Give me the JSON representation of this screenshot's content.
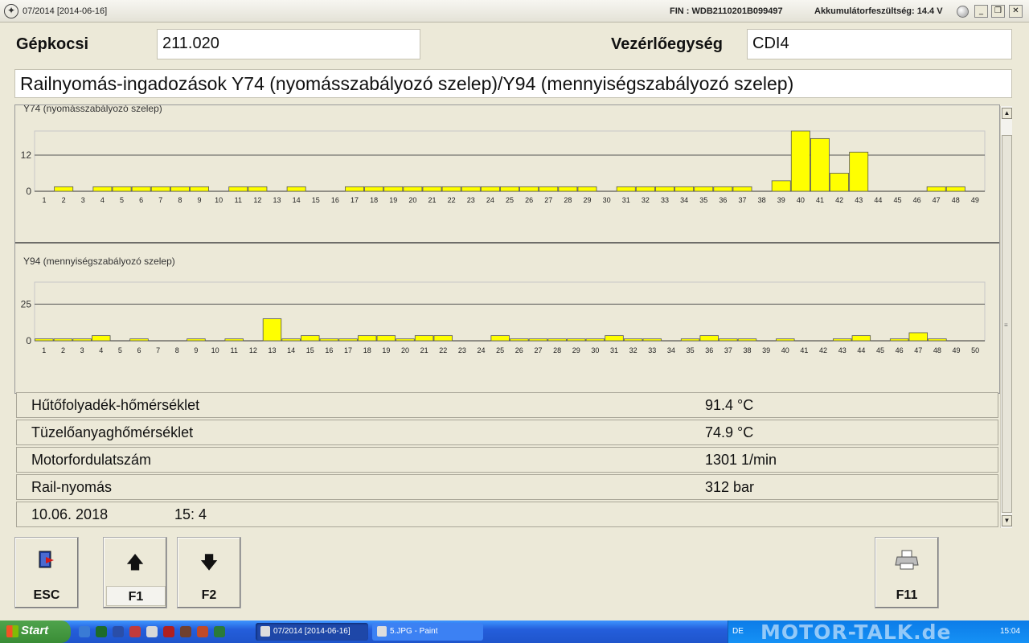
{
  "window": {
    "title": "07/2014 [2014-06-16]",
    "fin": "FIN : WDB2110201B099497",
    "battery": "Akkumulátorfeszültség: 14.4 V",
    "controls": {
      "minimize": "_",
      "restore": "❐",
      "close": "✕"
    }
  },
  "header": {
    "vehicle_label": "Gépkocsi",
    "vehicle_value": "211.020",
    "ecu_label": "Vezérlőegység",
    "ecu_value": "CDI4",
    "page_title": "Railnyomás-ingadozások Y74 (nyomásszabályozó szelep)/Y94 (mennyiségszabályozó szelep)"
  },
  "chart_data": [
    {
      "type": "bar",
      "title": "Y74 (nyomásszabályozó szelep)",
      "categories": [
        "1",
        "2",
        "3",
        "4",
        "5",
        "6",
        "7",
        "8",
        "9",
        "10",
        "11",
        "12",
        "13",
        "14",
        "15",
        "16",
        "17",
        "18",
        "19",
        "20",
        "21",
        "22",
        "23",
        "24",
        "25",
        "26",
        "27",
        "28",
        "29",
        "30",
        "31",
        "32",
        "33",
        "34",
        "35",
        "36",
        "37",
        "38",
        "39",
        "40",
        "41",
        "42",
        "43",
        "44",
        "45",
        "46",
        "47",
        "48",
        "49"
      ],
      "values": [
        0,
        1.5,
        0,
        1.5,
        1.5,
        1.5,
        1.5,
        1.5,
        1.5,
        0,
        1.5,
        1.5,
        0,
        1.5,
        0,
        0,
        1.5,
        1.5,
        1.5,
        1.5,
        1.5,
        1.5,
        1.5,
        1.5,
        1.5,
        1.5,
        1.5,
        1.5,
        1.5,
        0,
        1.5,
        1.5,
        1.5,
        1.5,
        1.5,
        1.5,
        1.5,
        0,
        3.5,
        20,
        17.5,
        6,
        13,
        0,
        0,
        0,
        1.5,
        1.5,
        0
      ],
      "yticks": [
        "0",
        "12"
      ],
      "ylim": [
        0,
        20
      ],
      "color": "#ffff00"
    },
    {
      "type": "bar",
      "title": "Y94 (mennyiségszabályozó szelep)",
      "categories": [
        "1",
        "2",
        "3",
        "4",
        "5",
        "6",
        "7",
        "8",
        "9",
        "10",
        "11",
        "12",
        "13",
        "14",
        "15",
        "16",
        "17",
        "18",
        "19",
        "20",
        "21",
        "22",
        "23",
        "24",
        "25",
        "26",
        "27",
        "28",
        "29",
        "30",
        "31",
        "32",
        "33",
        "34",
        "35",
        "36",
        "37",
        "38",
        "39",
        "40",
        "41",
        "42",
        "43",
        "44",
        "45",
        "46",
        "47",
        "48",
        "49",
        "50"
      ],
      "values": [
        1.3,
        1.3,
        1.3,
        3.5,
        0,
        1.3,
        0,
        0,
        1.3,
        0,
        1.3,
        0,
        15,
        1.3,
        3.5,
        1.3,
        1.3,
        3.5,
        3.5,
        1.3,
        3.5,
        3.5,
        0,
        0,
        3.5,
        1.3,
        1.3,
        1.3,
        1.3,
        1.3,
        3.5,
        1.3,
        1.3,
        0,
        1.3,
        3.5,
        1.3,
        1.3,
        0,
        1.3,
        0,
        0,
        1.3,
        3.5,
        0,
        1.3,
        5.5,
        1.3,
        0,
        0
      ],
      "yticks": [
        "0",
        "25"
      ],
      "ylim": [
        0,
        40
      ],
      "color": "#ffff00"
    }
  ],
  "readouts": [
    {
      "name": "Hűtőfolyadék-hőmérséklet",
      "value": "91.4 °C"
    },
    {
      "name": "Tüzelőanyaghőmérséklet",
      "value": "74.9 °C"
    },
    {
      "name": "Motorfordulatszám",
      "value": "1301 1/min"
    },
    {
      "name": "Rail-nyomás",
      "value": "312 bar"
    }
  ],
  "datetime": {
    "date": "10.06. 2018",
    "time": "15: 4"
  },
  "buttons": {
    "esc": {
      "label": "ESC",
      "icon": "exit-door-icon"
    },
    "f1": {
      "label": "F1",
      "icon": "arrow-up-icon"
    },
    "f2": {
      "label": "F2",
      "icon": "arrow-down-icon"
    },
    "f11": {
      "label": "F11",
      "icon": "printer-icon"
    }
  },
  "taskbar": {
    "start": "Start",
    "tasks": [
      "07/2014 [2014-06-16]",
      "5.JPG - Paint"
    ],
    "lang": "DE",
    "watermark": "MOTOR-TALK.de",
    "clock": "15:04"
  }
}
